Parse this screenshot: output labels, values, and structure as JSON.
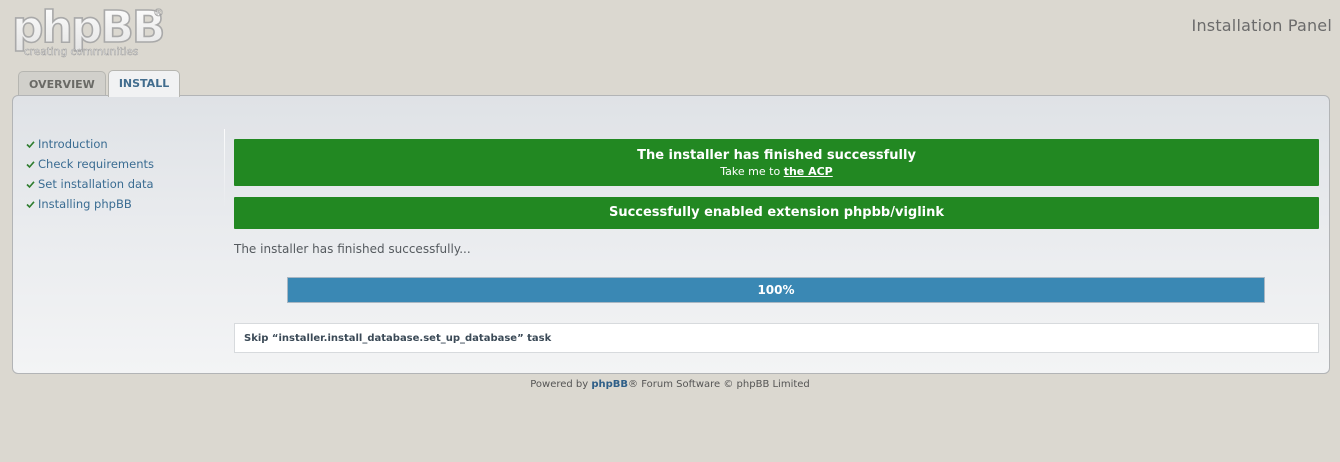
{
  "header": {
    "logo_word": "phpBB",
    "logo_tagline": "creating communities",
    "panel_title": "Installation Panel"
  },
  "tabs": [
    {
      "label": "OVERVIEW",
      "active": false
    },
    {
      "label": "INSTALL",
      "active": true
    }
  ],
  "sidebar": {
    "items": [
      {
        "label": "Introduction",
        "icon": "check-icon"
      },
      {
        "label": "Check requirements",
        "icon": "check-icon"
      },
      {
        "label": "Set installation data",
        "icon": "check-icon"
      },
      {
        "label": "Installing phpBB",
        "icon": "check-icon"
      }
    ]
  },
  "main": {
    "success_title": "The installer has finished successfully",
    "success_sub_prefix": "Take me to ",
    "success_link": "the ACP",
    "extension_message": "Successfully enabled extension phpbb/viglink",
    "status_text": "The installer has finished successfully...",
    "progress": {
      "value": 100,
      "label": "100%"
    },
    "log_message": "Skip “installer.install_database.set_up_database” task"
  },
  "footer": {
    "prefix": "Powered by ",
    "link": "phpBB",
    "suffix": "® Forum Software © phpBB Limited"
  },
  "colors": {
    "background": "#dbd8d0",
    "success": "#228822",
    "progress": "#3a88b4",
    "link": "#3a6c92"
  }
}
